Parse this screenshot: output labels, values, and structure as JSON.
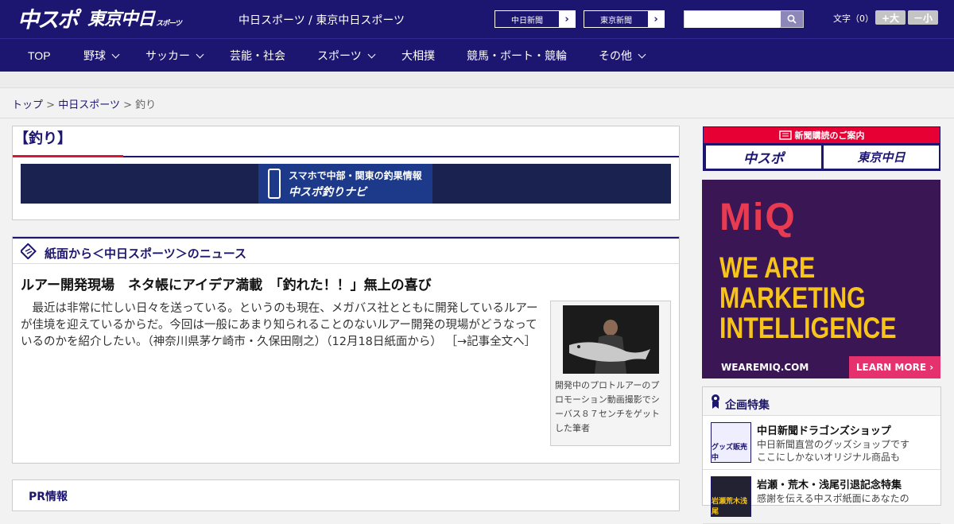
{
  "header": {
    "logo_main": "中スポ",
    "logo_tokyo": "東京中日",
    "logo_tokyo_small": "スポーツ",
    "site_desc": "中日スポーツ / 東京中日スポーツ",
    "btn_chunichi": "中日新聞",
    "btn_tokyo": "東京新聞",
    "arrow": "›",
    "search_placeholder": "",
    "font_label": "文字（0）",
    "font_bigger": "+大",
    "font_smaller": "－小"
  },
  "nav": {
    "items": [
      {
        "label": "TOP"
      },
      {
        "label": "野球"
      },
      {
        "label": "サッカー"
      },
      {
        "label": "芸能・社会"
      },
      {
        "label": "スポーツ"
      },
      {
        "label": "大相撲"
      },
      {
        "label": "競馬・ボート・競輪"
      },
      {
        "label": "その他"
      }
    ]
  },
  "breadcrumb": {
    "items": [
      "トップ",
      "中日スポーツ",
      "釣り"
    ],
    "separator": ">"
  },
  "page": {
    "title": "【釣り】",
    "banner_line1": "スマホで中部・関東の釣果情報",
    "banner_line2": "中スポ釣りナビ"
  },
  "section": {
    "heading": "紙面から＜中日スポーツ＞のニュース",
    "article_title": "ルアー開発現場　ネタ帳にアイデア満載　「釣れた！！」無上の喜び",
    "article_body": "最近は非常に忙しい日々を送っている。というのも現在、メガバス社とともに開発しているルアーが佳境を迎えているからだ。今回は一般にあまり知られることのないルアー開発の現場がどうなっているのかを紹介したい。（神奈川県茅ケ崎市・久保田剛之）（12月18日紙面から）",
    "more_link": "［→記事全文へ］",
    "photo_caption": "開発中のプロトルアーのプロモーション動画撮影でシーバス８７センチをゲットした筆者"
  },
  "pr": {
    "label": "PR情報"
  },
  "sidebar": {
    "subscribe_header": "新聞購読のご案内",
    "subscribe_chuspo": "中スポ",
    "subscribe_tokyo": "東京中日",
    "ad_logo": "MiQ",
    "ad_line1": "WE ARE",
    "ad_line2": "MARKETING",
    "ad_line3": "INTELLIGENCE",
    "ad_url": "WEAREMIQ.COM",
    "ad_cta": "LEARN MORE ›",
    "feature_heading": "企画特集",
    "features": [
      {
        "thumb": "グッズ販売中",
        "title": "中日新聞ドラゴンズショップ",
        "desc1": "中日新聞直営のグッズショップです",
        "desc2": "ここにしかないオリジナル商品も"
      },
      {
        "thumb": "岩瀬荒木浅尾",
        "title": "岩瀬・荒木・浅尾引退記念特集",
        "desc1": "感謝を伝える中スポ紙面にあなたの",
        "desc2": ""
      }
    ]
  },
  "colors": {
    "brand_navy": "#1d1670",
    "accent_red": "#d4183c",
    "ad_purple": "#3a1655",
    "ad_yellow": "#f6c41a"
  }
}
